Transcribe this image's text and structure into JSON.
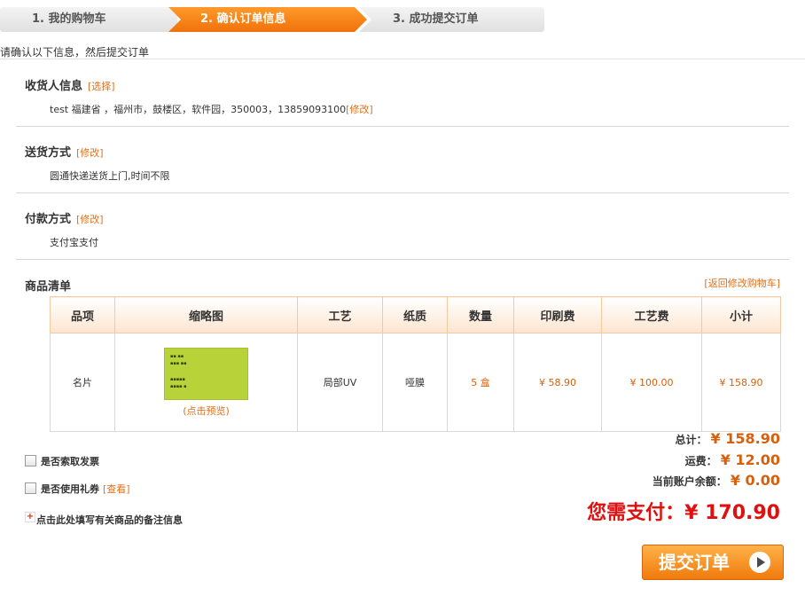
{
  "steps": [
    "1. 我的购物车",
    "2. 确认订单信息",
    "3. 成功提交订单"
  ],
  "note": "请确认以下信息，然后提交订单",
  "receiver": {
    "title": "收货人信息",
    "action": "[选择]",
    "info": "test 福建省 ，福州市，鼓楼区，软件园，350003，13859093100",
    "modify": "[修改]"
  },
  "shipping": {
    "title": "送货方式",
    "modify": "[修改]",
    "value": "圆通快递送货上门,时间不限"
  },
  "payment": {
    "title": "付款方式",
    "modify": "[修改]",
    "value": "支付宝支付"
  },
  "goods": {
    "title": "商品清单",
    "back_link": "[返回修改购物车]",
    "headers": [
      "品项",
      "缩略图",
      "工艺",
      "纸质",
      "数量",
      "印刷费",
      "工艺费",
      "小计"
    ],
    "row": {
      "item": "名片",
      "preview": "(点击预览)",
      "craft": "局部UV",
      "paper": "哑膜",
      "qty": "5 盒",
      "print_fee": "¥ 58.90",
      "craft_fee": "¥ 100.00",
      "subtotal": "¥ 158.90"
    }
  },
  "options": {
    "invoice": "是否索取发票",
    "coupon": "是否使用礼券",
    "coupon_view": "[查看]",
    "remark": "点击此处填写有关商品的备注信息"
  },
  "totals": {
    "total_label": "总计：",
    "total": "¥ 158.90",
    "freight_label": "运费：",
    "freight": "¥ 12.00",
    "balance_label": "当前账户余额：",
    "balance": "¥ 0.00",
    "pay_label": "您需支付：",
    "pay": "¥ 170.90"
  },
  "submit_label": "提交订单"
}
